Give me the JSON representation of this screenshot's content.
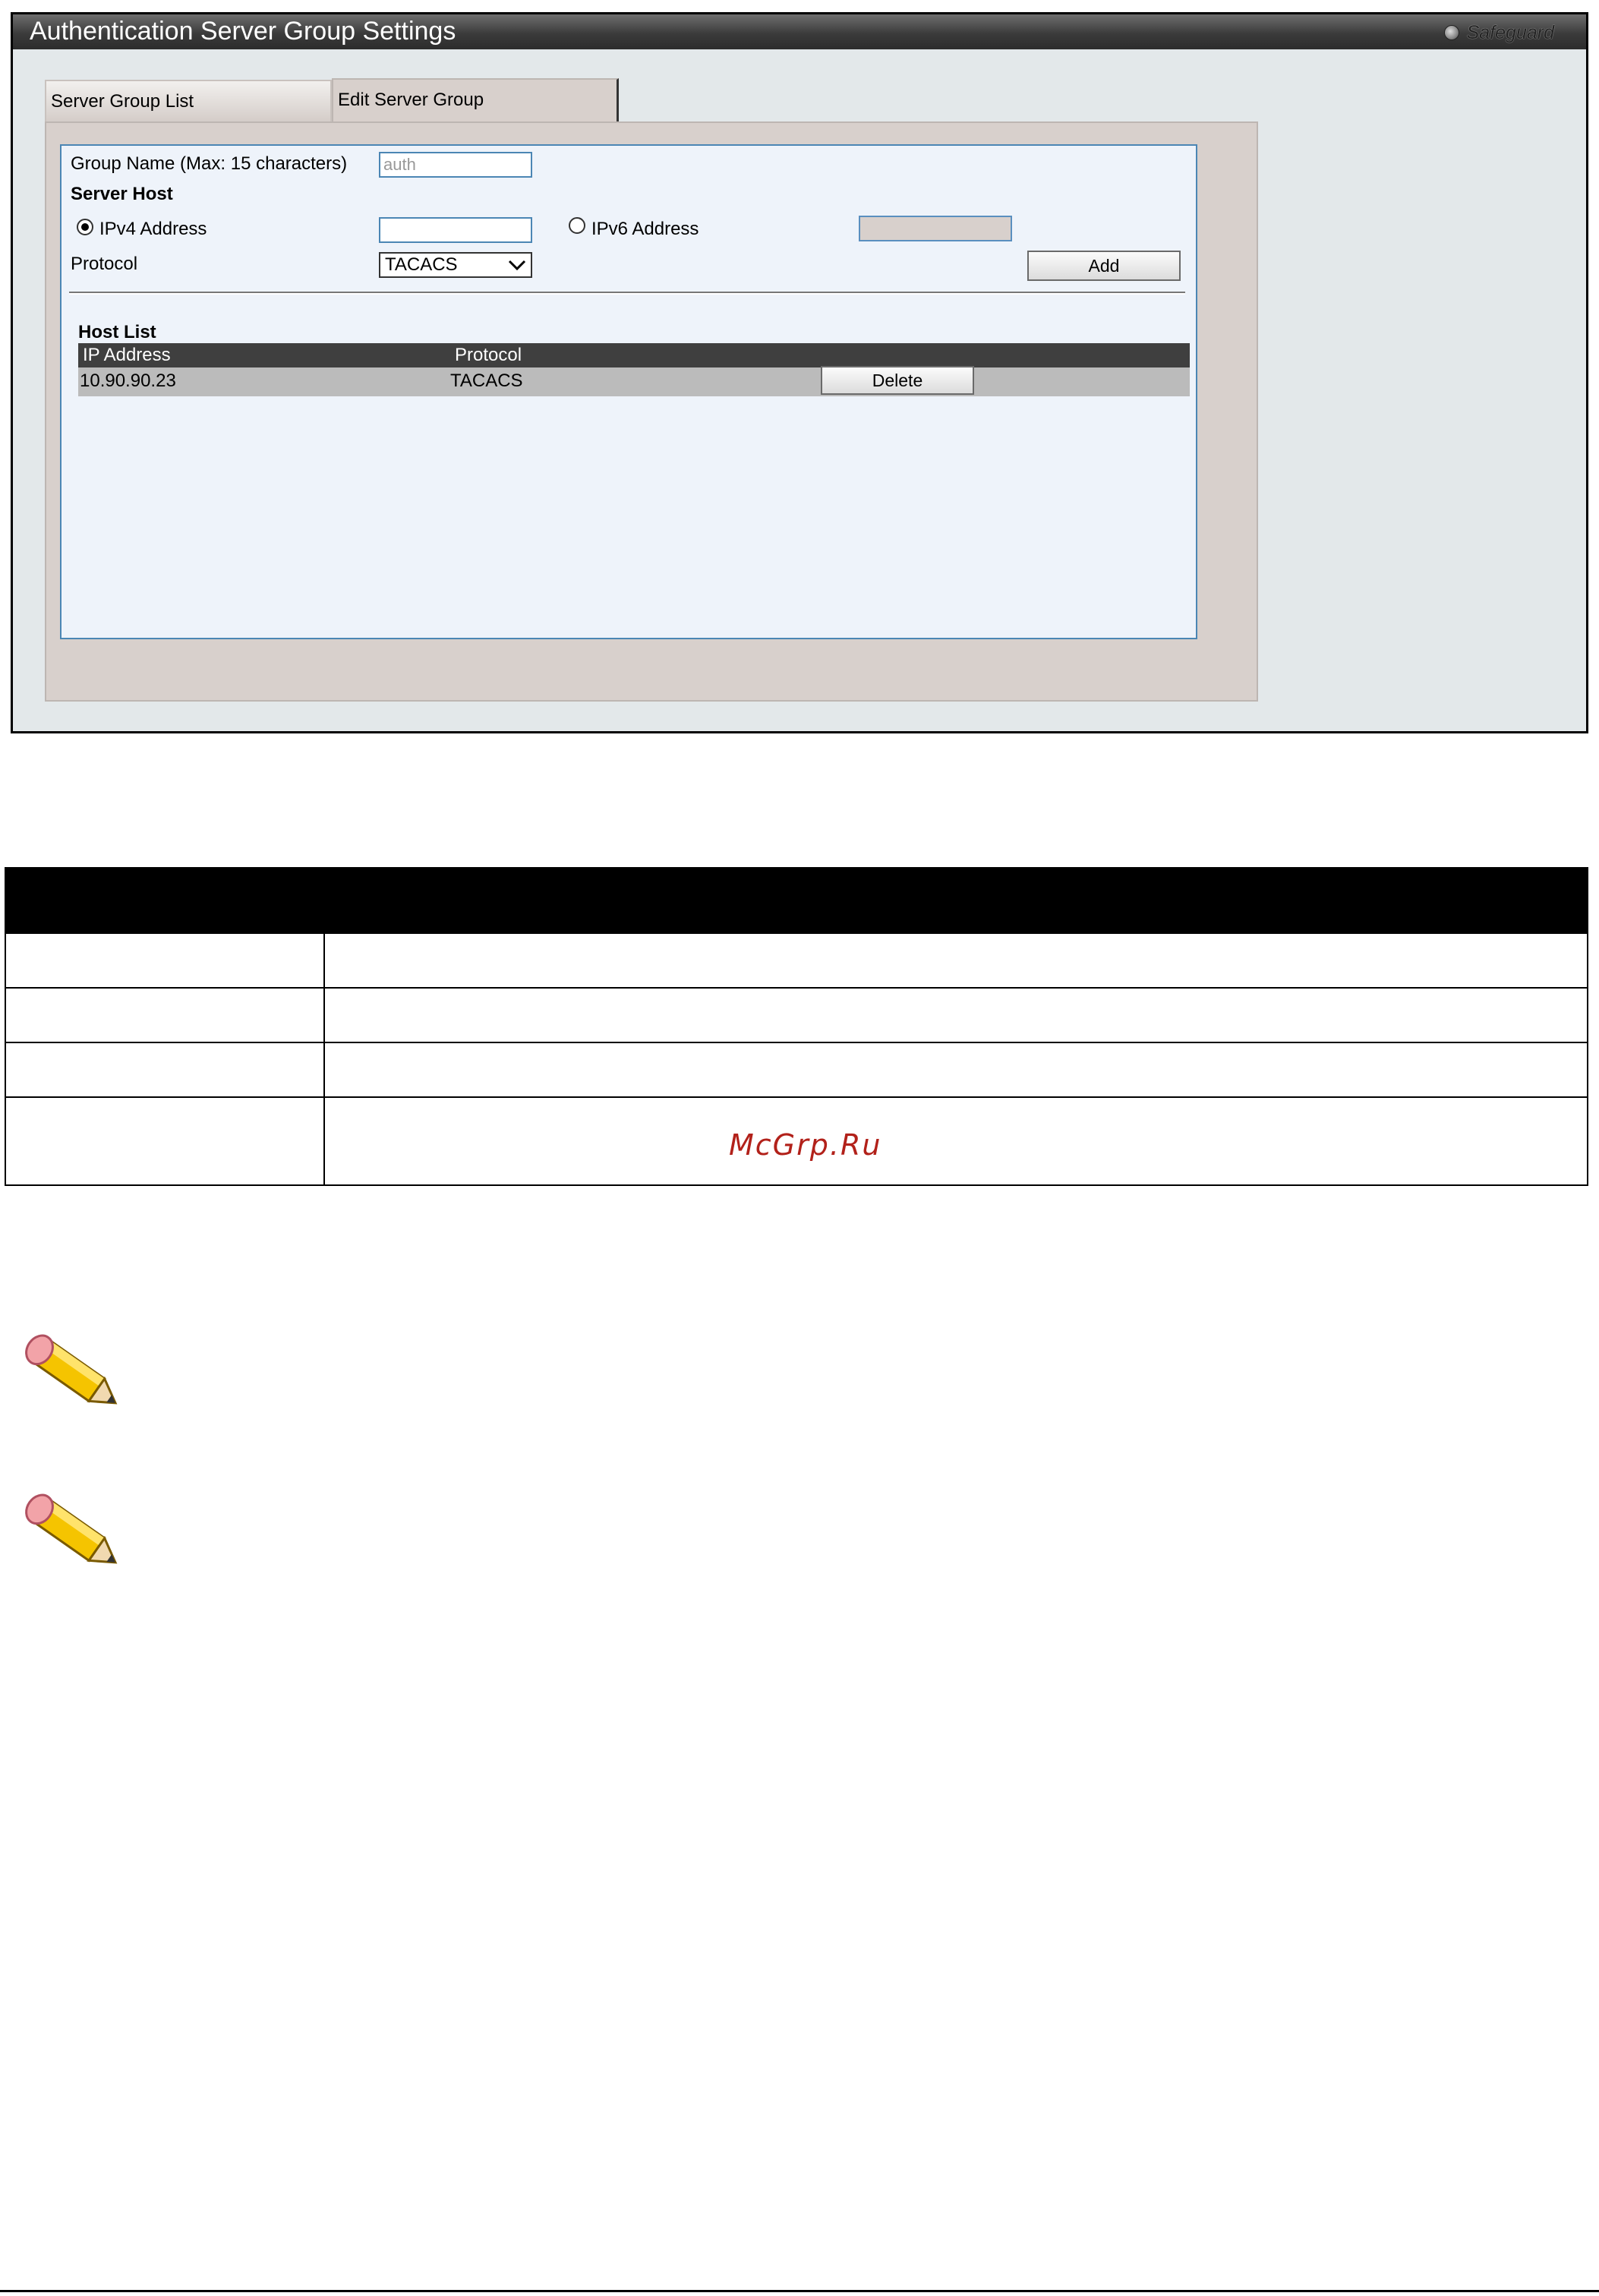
{
  "window": {
    "title": "Authentication Server Group Settings",
    "safeguard_label": "Safeguard"
  },
  "tabs": [
    {
      "label": "Server Group List"
    },
    {
      "label": "Edit Server Group"
    }
  ],
  "form": {
    "group_name_label": "Group Name  (Max: 15 characters)",
    "group_name_value": "auth",
    "server_host_label": "Server Host",
    "ipv4_label": "IPv4 Address",
    "ipv4_value": "",
    "ipv4_selected": true,
    "ipv6_label": "IPv6 Address",
    "ipv6_value": "",
    "protocol_label": "Protocol",
    "protocol_value": "TACACS",
    "add_label": "Add"
  },
  "host_list": {
    "title": "Host List",
    "columns": [
      "IP Address",
      "Protocol"
    ],
    "rows": [
      {
        "ip": "10.90.90.23",
        "protocol": "TACACS",
        "action": "Delete"
      }
    ]
  },
  "watermark": "McGrp.Ru",
  "note_icons": [
    "pencil-icon",
    "pencil-icon"
  ]
}
